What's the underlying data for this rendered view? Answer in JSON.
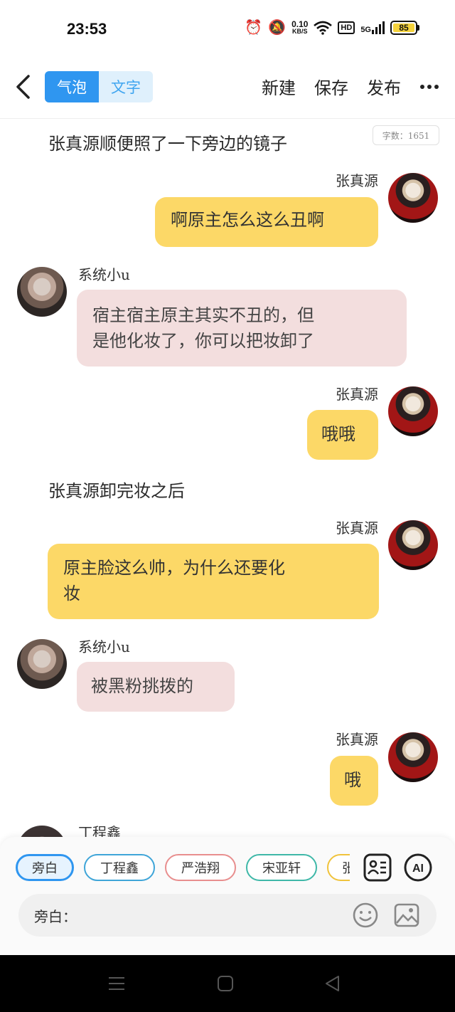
{
  "status_bar": {
    "time": "23:53",
    "net_speed_value": "0.10",
    "net_speed_unit": "KB/S",
    "hd": "HD",
    "network": "5G",
    "battery": "85"
  },
  "toolbar": {
    "tabs": [
      {
        "label": "气泡",
        "active": true
      },
      {
        "label": "文字",
        "active": false
      }
    ],
    "new_label": "新建",
    "save_label": "保存",
    "publish_label": "发布"
  },
  "word_count": "字数：1651",
  "chat": {
    "narration_1": "张真源顺便照了一下旁边的镜子",
    "msg1_name": "张真源",
    "msg1_text": "啊原主怎么这么丑啊",
    "msg2_name": "系统小u",
    "msg2_line1": "宿主宿主原主其实不丑的，但",
    "msg2_line2": "是他化妆了，你可以把妆卸了",
    "msg3_name": "张真源",
    "msg3_text": "哦哦",
    "narration_2": "张真源卸完妆之后",
    "msg4_name": "张真源",
    "msg4_line1": "原主脸这么帅，为什么还要化",
    "msg4_line2": "妆",
    "msg5_name": "系统小u",
    "msg5_text": "被黑粉挑拨的",
    "msg6_name": "张真源",
    "msg6_text": "哦",
    "msg7_name": "丁程鑫"
  },
  "characters": [
    "旁白",
    "丁程鑫",
    "严浩翔",
    "宋亚轩",
    "张"
  ],
  "input": {
    "label": "旁白：",
    "placeholder": ""
  },
  "icons": {
    "back": "chevron-left-icon",
    "more": "more-dots-icon",
    "character_card": "character-card-icon",
    "ai": "AI",
    "emoji": "smile-icon",
    "image": "image-icon"
  },
  "colors": {
    "accent": "#2f96f0",
    "right_bubble": "#fcd867",
    "left_bubble": "#f3dede"
  }
}
